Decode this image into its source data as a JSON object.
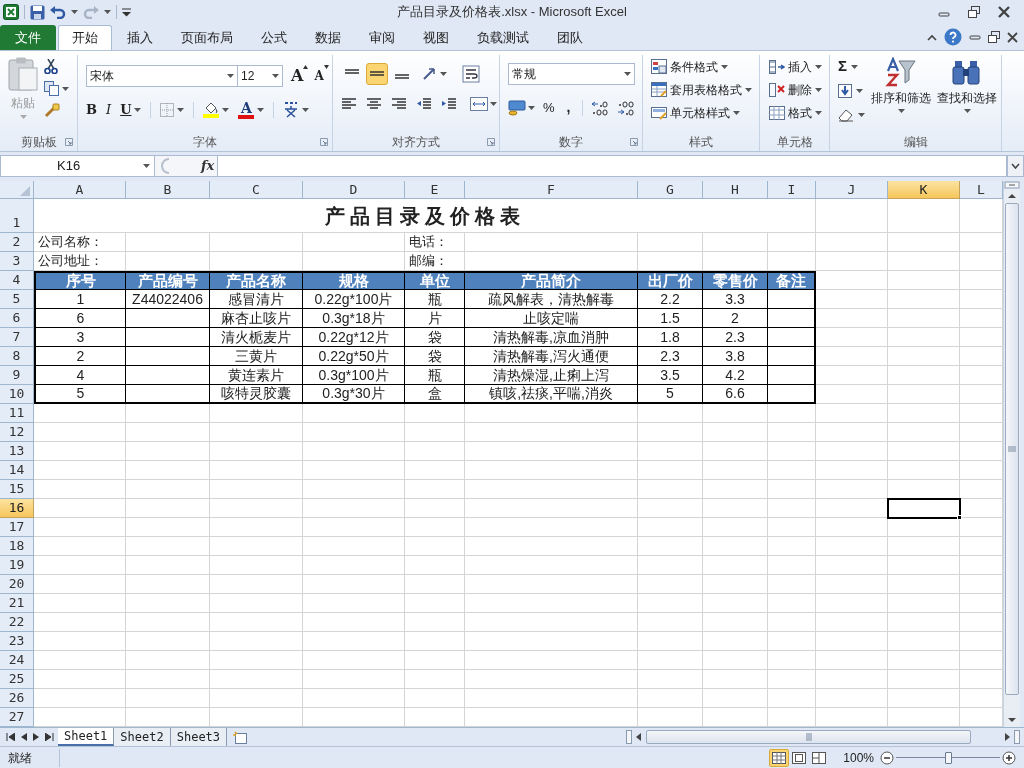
{
  "window": {
    "title": "产品目录及价格表.xlsx - Microsoft Excel"
  },
  "ribbon_tabs": [
    {
      "label": "文件",
      "kind": "file",
      "selected": false
    },
    {
      "label": "开始",
      "kind": "tab",
      "selected": true
    },
    {
      "label": "插入",
      "kind": "tab",
      "selected": false
    },
    {
      "label": "页面布局",
      "kind": "tab",
      "selected": false
    },
    {
      "label": "公式",
      "kind": "tab",
      "selected": false
    },
    {
      "label": "数据",
      "kind": "tab",
      "selected": false
    },
    {
      "label": "审阅",
      "kind": "tab",
      "selected": false
    },
    {
      "label": "视图",
      "kind": "tab",
      "selected": false
    },
    {
      "label": "负载测试",
      "kind": "tab",
      "selected": false
    },
    {
      "label": "团队",
      "kind": "tab",
      "selected": false
    }
  ],
  "clipboard": {
    "paste": "粘贴",
    "label": "剪贴板"
  },
  "font": {
    "name": "宋体",
    "size": "12",
    "grow": "A",
    "shrink": "A",
    "bold": "B",
    "italic": "I",
    "underline": "U",
    "font_color": "A",
    "label": "字体"
  },
  "alignment": {
    "vertical": [
      {
        "kind": "top",
        "selected": false
      },
      {
        "kind": "middle",
        "selected": true
      },
      {
        "kind": "bottom",
        "selected": false
      }
    ],
    "label": "对齐方式"
  },
  "number": {
    "format": "常规",
    "percent": "%",
    "comma": ",",
    "label": "数字"
  },
  "styles": {
    "items": [
      "条件格式",
      "套用表格格式",
      "单元格样式"
    ],
    "label": "样式"
  },
  "cells_group": {
    "items": [
      "插入",
      "删除",
      "格式"
    ],
    "label": "单元格"
  },
  "editing": {
    "sum": "Σ",
    "buttons": [
      "排序和筛选",
      "查找和选择"
    ],
    "label": "编辑"
  },
  "formula_bar": {
    "name_box": "K16",
    "function_label": "fx"
  },
  "sheet": {
    "columns": [
      {
        "label": "A",
        "selected": false
      },
      {
        "label": "B",
        "selected": false
      },
      {
        "label": "C",
        "selected": false
      },
      {
        "label": "D",
        "selected": false
      },
      {
        "label": "E",
        "selected": false
      },
      {
        "label": "F",
        "selected": false
      },
      {
        "label": "G",
        "selected": false
      },
      {
        "label": "H",
        "selected": false
      },
      {
        "label": "I",
        "selected": false
      },
      {
        "label": "J",
        "selected": false
      },
      {
        "label": "K",
        "selected": true
      },
      {
        "label": "L",
        "selected": false
      }
    ],
    "rows": [
      {
        "header": "1",
        "kind": "title",
        "selected": false,
        "title": "产品目录及价格表"
      },
      {
        "header": "2",
        "kind": "info",
        "selected": false,
        "cells": {
          "A": "公司名称：",
          "E": "电话："
        }
      },
      {
        "header": "3",
        "kind": "info",
        "selected": false,
        "cells": {
          "A": "公司地址：",
          "E": "邮编："
        }
      },
      {
        "header": "4",
        "kind": "header",
        "selected": false,
        "cells": {
          "A": "序号",
          "B": "产品编号",
          "C": "产品名称",
          "D": "规格",
          "E": "单位",
          "F": "产品简介",
          "G": "出厂价",
          "H": "零售价",
          "I": "备注"
        }
      },
      {
        "header": "5",
        "kind": "data",
        "selected": false,
        "cells": {
          "A": "1",
          "B": "Z44022406",
          "C": "感冒清片",
          "D": "0.22g*100片",
          "E": "瓶",
          "F": "疏风解表，清热解毒",
          "G": "2.2",
          "H": "3.3"
        }
      },
      {
        "header": "6",
        "kind": "data",
        "selected": false,
        "cells": {
          "A": "6",
          "C": "麻杏止咳片",
          "D": "0.3g*18片",
          "E": "片",
          "F": "止咳定喘",
          "G": "1.5",
          "H": "2"
        }
      },
      {
        "header": "7",
        "kind": "data",
        "selected": false,
        "cells": {
          "A": "3",
          "C": "清火栀麦片",
          "D": "0.22g*12片",
          "E": "袋",
          "F": "清热解毒,凉血消肿",
          "G": "1.8",
          "H": "2.3"
        }
      },
      {
        "header": "8",
        "kind": "data",
        "selected": false,
        "cells": {
          "A": "2",
          "C": "三黄片",
          "D": "0.22g*50片",
          "E": "袋",
          "F": "清热解毒,泻火通便",
          "G": "2.3",
          "H": "3.8"
        }
      },
      {
        "header": "9",
        "kind": "data",
        "selected": false,
        "cells": {
          "A": "4",
          "C": "黄连素片",
          "D": "0.3g*100片",
          "E": "瓶",
          "F": "清热燥湿,止痢上泻",
          "G": "3.5",
          "H": "4.2"
        }
      },
      {
        "header": "10",
        "kind": "data",
        "selected": false,
        "cells": {
          "A": "5",
          "C": "咳特灵胶囊",
          "D": "0.3g*30片",
          "E": "盒",
          "F": "镇咳,祛痰,平喘,消炎",
          "G": "5",
          "H": "6.6"
        }
      },
      {
        "header": "11",
        "kind": "plain",
        "selected": false
      },
      {
        "header": "12",
        "kind": "plain",
        "selected": false
      },
      {
        "header": "13",
        "kind": "plain",
        "selected": false
      },
      {
        "header": "14",
        "kind": "plain",
        "selected": false
      },
      {
        "header": "15",
        "kind": "plain",
        "selected": false
      },
      {
        "header": "16",
        "kind": "plain",
        "selected": true
      },
      {
        "header": "17",
        "kind": "plain",
        "selected": false
      },
      {
        "header": "18",
        "kind": "plain",
        "selected": false
      },
      {
        "header": "19",
        "kind": "plain",
        "selected": false
      },
      {
        "header": "20",
        "kind": "plain",
        "selected": false
      },
      {
        "header": "21",
        "kind": "plain",
        "selected": false
      },
      {
        "header": "22",
        "kind": "plain",
        "selected": false
      },
      {
        "header": "23",
        "kind": "plain",
        "selected": false
      },
      {
        "header": "24",
        "kind": "plain",
        "selected": false
      },
      {
        "header": "25",
        "kind": "plain",
        "selected": false
      },
      {
        "header": "26",
        "kind": "plain",
        "selected": false
      },
      {
        "header": "27",
        "kind": "plain",
        "selected": false
      }
    ]
  },
  "sheet_tabs": [
    {
      "label": "Sheet1",
      "selected": true
    },
    {
      "label": "Sheet2",
      "selected": false
    },
    {
      "label": "Sheet3",
      "selected": false
    }
  ],
  "status_bar": {
    "status": "就绪",
    "views": [
      {
        "kind": "normal",
        "selected": true
      },
      {
        "kind": "page_layout",
        "selected": false
      },
      {
        "kind": "page_break",
        "selected": false
      }
    ],
    "zoom": "100%",
    "zoom_slider": {
      "level": 0.5
    }
  }
}
